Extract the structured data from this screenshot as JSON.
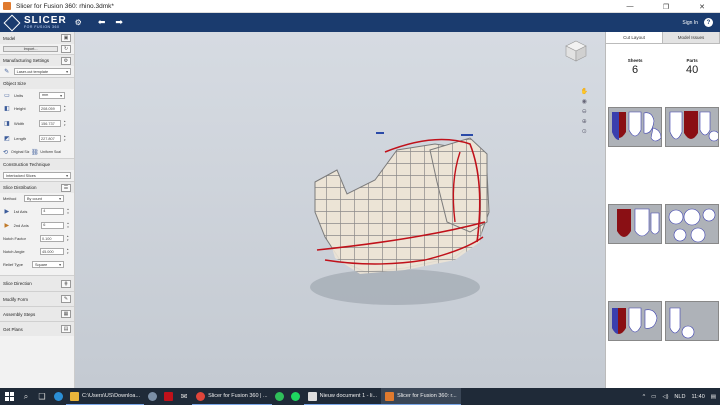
{
  "window": {
    "title": "Slicer for Fusion 360: rhino.3dmk*",
    "controls": [
      "—",
      "❐",
      "✕"
    ]
  },
  "header": {
    "brand": "SLICER",
    "brand_sub": "FOR FUSION 360",
    "sign_in": "Sign In",
    "help": "?"
  },
  "left_panel": {
    "model": {
      "title": "Model",
      "import_label": "Import..."
    },
    "manufacturing": {
      "title": "Manufacturing Settings",
      "value": "Laser-cut template"
    },
    "object_size": {
      "title": "Object Size",
      "units_label": "Units",
      "units_value": "mm",
      "height_label": "Height",
      "height_value": "208.059",
      "width_label": "Width",
      "width_value": "156.737",
      "length_label": "Length",
      "length_value": "227.807",
      "original_size": "Original Siz",
      "uniform_scale": "Uniform Scal"
    },
    "construction": {
      "title": "Construction Technique",
      "value": "Interlocked Slices"
    },
    "slice_distribution": {
      "title": "Slice Distribution",
      "method_label": "Method",
      "method_value": "By count",
      "axis1_label": "1st Axis",
      "axis1_value": "4",
      "axis2_label": "2nd Axis",
      "axis2_value": "6",
      "notch_factor_label": "Notch Factor",
      "notch_factor_value": "0.100",
      "notch_angle_label": "Notch Angle",
      "notch_angle_value": "45.000",
      "relief_type_label": "Relief Type",
      "relief_type_value": "Square"
    },
    "slice_direction": "Slice Direction",
    "modify_form": "Modify Form",
    "assembly_steps": "Assembly Steps",
    "get_plans": "Get Plans"
  },
  "right_panel": {
    "tab_cut_layout": "Cut Layout",
    "tab_model_issues": "Model Issues",
    "sheets_label": "Sheets",
    "sheets_value": "6",
    "parts_label": "Parts",
    "parts_value": "40"
  },
  "taskbar": {
    "explorer": "C:\\Users\\US\\Downloa...",
    "chrome": "Slicer for Fusion 360 | ...",
    "doc": "Nieuw document 1 - li...",
    "slicer": "Slicer for Fusion 360: r...",
    "lang": "NLD",
    "time": "11:40"
  },
  "colors": {
    "header_bg": "#1a3b6e",
    "accent_red": "#c0111a",
    "slice_part": "#ece4d6"
  }
}
